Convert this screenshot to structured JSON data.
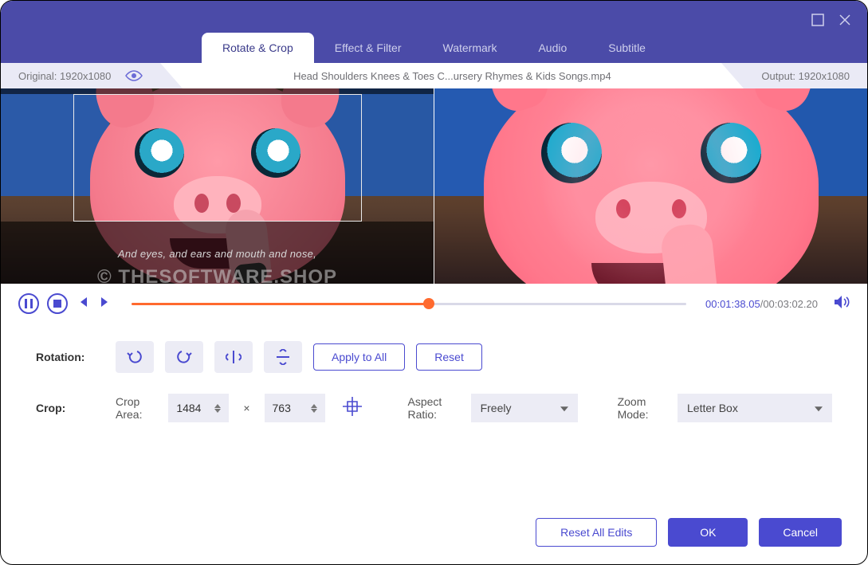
{
  "tabs": {
    "rotate_crop": "Rotate & Crop",
    "effect_filter": "Effect & Filter",
    "watermark": "Watermark",
    "audio": "Audio",
    "subtitle": "Subtitle"
  },
  "info": {
    "original_label": "Original: 1920x1080",
    "filename": "Head Shoulders Knees & Toes  C...ursery Rhymes & Kids Songs.mp4",
    "output_label": "Output: 1920x1080"
  },
  "preview": {
    "subtitle_overlay": "And eyes, and ears and mouth and nose,",
    "watermark": "© THESOFTWARE.SHOP"
  },
  "playback": {
    "progress_percent": 53.6,
    "current_time": "00:01:38.05",
    "total_time": "00:03:02.20",
    "separator": "/"
  },
  "rotation": {
    "label": "Rotation:",
    "apply_all": "Apply to All",
    "reset": "Reset"
  },
  "crop": {
    "label": "Crop:",
    "area_label": "Crop Area:",
    "width": "1484",
    "height": "763",
    "multiply": "×",
    "aspect_label": "Aspect Ratio:",
    "aspect_value": "Freely",
    "zoom_label": "Zoom Mode:",
    "zoom_value": "Letter Box"
  },
  "footer": {
    "reset_all": "Reset All Edits",
    "ok": "OK",
    "cancel": "Cancel"
  }
}
